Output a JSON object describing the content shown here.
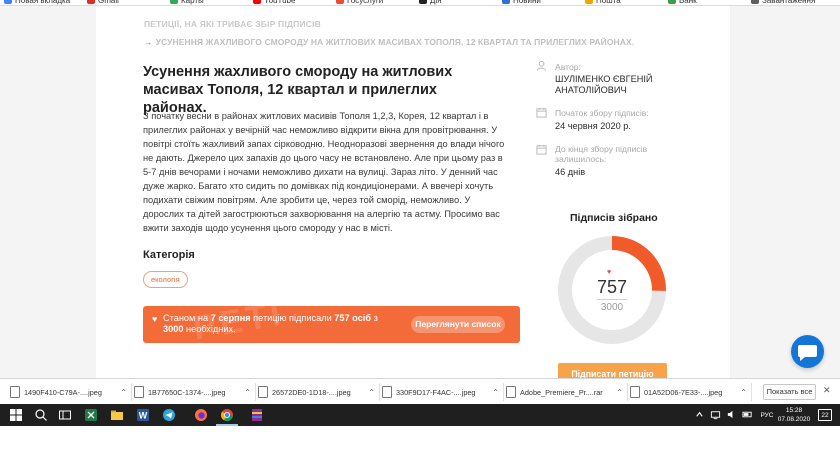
{
  "page": {
    "breadcrumb_parent": "ПЕТИЦІЇ, НА ЯКІ ТРИВАЄ ЗБІР ПІДПИСІВ",
    "breadcrumb_current": "УСУНЕННЯ ЖАХЛИВОГО СМОРОДУ НА ЖИТЛОВИХ МАСИВАХ ТОПОЛЯ, 12 КВАРТАЛ ТА ПРИЛЕГЛИХ РАЙОНАХ.",
    "breadcrumb_arrow": "→",
    "title": "Усунення жахливого смороду на житлових масивах Тополя, 12 квартал и прилеглих районах.",
    "body": "З початку весни в районах житлових масивів Тополя 1,2,3, Корея, 12 квартал і в прилеглих районах у вечірній час неможливо відкрити вікна для провітрювання. У повітрі стоїть жахливий запах сірководню. Неодноразові звернення до влади нічого не дають. Джерело цих запахів до цього часу не встановлено. Але при цьому раз в 5-7 днів вечорами і ночами неможливо дихати на вулиці. Зараз літо. У денний час дуже жарко. Багато хто сидить по домівках під кондиціонерами. А ввечері хочуть подихати свіжим повітрям. Але зробити це, через той сморід, неможливо. У дорослих та дітей загострюються захворювання на алергію та астму. Просимо вас вжити заходів щодо усунення цього смороду у нас в місті.",
    "category_heading": "Категорія",
    "category_tag": "екологія",
    "banner": {
      "prefix": "Станом на",
      "date": "7 серпня",
      "middle": "петицію підписали",
      "count": "757 осіб",
      "from": "з",
      "target": "3000",
      "suffix": "необхідних.",
      "watermark": "PETI",
      "button": "Переглянути список"
    },
    "author_label": "Автор:",
    "author_name": "ШУЛІМЕНКО ЄВГЕНІЙ АНАТОЛІЙОВИЧ",
    "start_label": "Початок збору підписів:",
    "start_value": "24 червня 2020 р.",
    "remaining_label": "До кінця збору підписів залишилось:",
    "remaining_value": "46 днів",
    "signatures_title": "Підписів зібрано",
    "signed": 757,
    "needed": 3000,
    "signed_text": "757",
    "needed_text": "3000",
    "progress_fraction": 0.2523,
    "sign_button": "Підписати петицію",
    "accent_color": "#f15a29",
    "gauge_track_color": "#e6e6e6"
  },
  "bookmarks": [
    {
      "label": "Новая вкладка",
      "color": "#4285f4"
    },
    {
      "label": "Gmail",
      "color": "#d93025"
    },
    {
      "label": "Карты",
      "color": "#34a853"
    },
    {
      "label": "YouTube",
      "color": "#ff0000"
    },
    {
      "label": "Госуслуги",
      "color": "#e94c3d"
    },
    {
      "label": "Дія",
      "color": "#222222"
    },
    {
      "label": "Новини",
      "color": "#2f6fd1"
    },
    {
      "label": "Пошта",
      "color": "#f0a500"
    },
    {
      "label": "Банк",
      "color": "#3f9e42"
    },
    {
      "label": "Завантаження",
      "color": "#5e5e5e"
    }
  ],
  "downloads": [
    {
      "name": "1490F410-C79A-....jpeg"
    },
    {
      "name": "1B77650C-1374-....jpeg"
    },
    {
      "name": "26572DE0-1D18-....jpeg"
    },
    {
      "name": "330F9D17-F4AC-....jpeg"
    },
    {
      "name": "Adobe_Premiere_Pr....rar"
    },
    {
      "name": "01A52D06-7E33-....jpeg"
    }
  ],
  "downloads_show_all": "Показать все",
  "downloads_close": "✕",
  "taskbar": {
    "language": "РУС",
    "time": "15:28",
    "date": "07.08.2020",
    "notifications": "22"
  }
}
